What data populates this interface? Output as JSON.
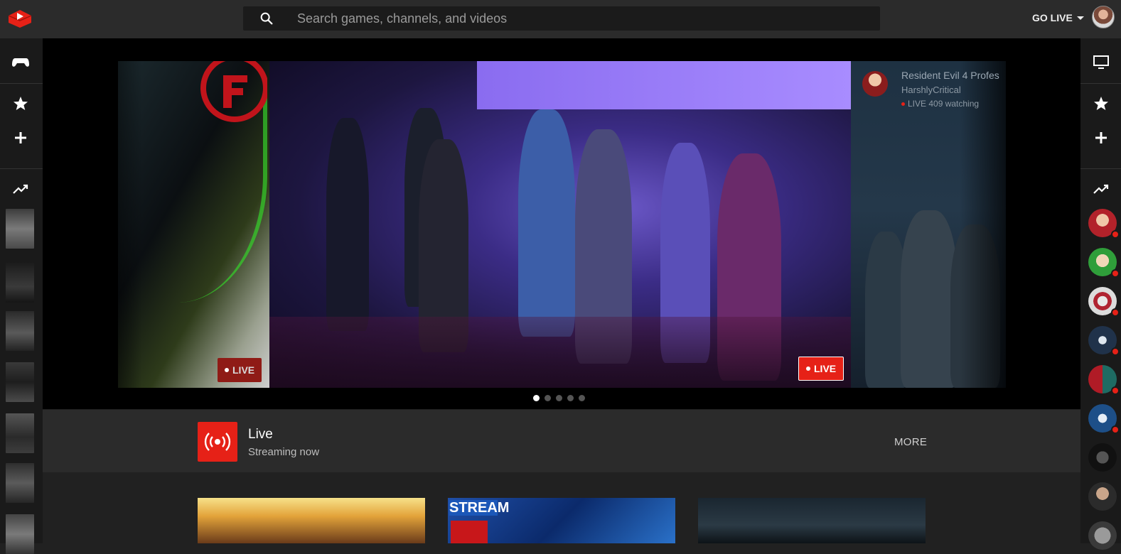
{
  "search": {
    "placeholder": "Search games, channels, and videos"
  },
  "header": {
    "go_live_label": "GO LIVE"
  },
  "hero": {
    "badges": {
      "left_live": "LIVE",
      "main_live": "LIVE"
    },
    "right_slide": {
      "title": "Resident Evil 4 Profes",
      "channel": "HarshlyCritical",
      "watching": "LIVE 409 watching"
    },
    "pager_count": 5,
    "active_page": 0
  },
  "shelf": {
    "title": "Live",
    "subtitle": "Streaming now",
    "more_label": "MORE"
  },
  "cards": [
    {
      "label": ""
    },
    {
      "label": "STREAM"
    },
    {
      "label": ""
    }
  ],
  "colors": {
    "brand_red": "#e62117",
    "topbar": "#2b2b2b",
    "rail": "#1a1a1a"
  }
}
